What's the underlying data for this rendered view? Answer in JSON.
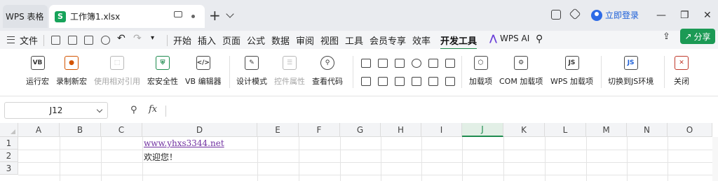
{
  "titlebar": {
    "app_tab": "WPS 表格",
    "doc_tab": "工作簿1.xlsx",
    "doc_icon": "S",
    "new_tab": "+",
    "login": "立即登录",
    "win_minimize": "—",
    "win_maximize": "❐",
    "win_close": "✕"
  },
  "menubar": {
    "file": "文件",
    "items": [
      "开始",
      "插入",
      "页面",
      "公式",
      "数据",
      "审阅",
      "视图",
      "工具",
      "会员专享",
      "效率",
      "开发工具",
      "WPS AI"
    ],
    "active": "开发工具",
    "share": "分享"
  },
  "ribbon": {
    "buttons": [
      {
        "label": "运行宏",
        "glyph": "VB",
        "disabled": false
      },
      {
        "label": "录制新宏",
        "glyph": "●",
        "disabled": false
      },
      {
        "label": "使用相对引用",
        "glyph": "⬚",
        "disabled": true
      },
      {
        "label": "宏安全性",
        "glyph": "⛨",
        "disabled": false
      },
      {
        "label": "VB 编辑器",
        "glyph": "</>",
        "disabled": false
      },
      {
        "label": "设计模式",
        "glyph": "✎",
        "disabled": false
      },
      {
        "label": "控件属性",
        "glyph": "☰",
        "disabled": true
      },
      {
        "label": "查看代码",
        "glyph": "⚲",
        "disabled": false
      },
      {
        "label": "加载项",
        "glyph": "⬡",
        "disabled": false
      },
      {
        "label": "COM 加载项",
        "glyph": "⚙",
        "disabled": false
      },
      {
        "label": "WPS 加载项",
        "glyph": "JS",
        "disabled": false
      },
      {
        "label": "切换到JS环境",
        "glyph": "JS",
        "disabled": false
      },
      {
        "label": "关闭",
        "glyph": "✕",
        "disabled": false
      }
    ]
  },
  "formulabar": {
    "namebox": "J12",
    "fx": "fx",
    "value": ""
  },
  "sheet": {
    "columns": [
      "A",
      "B",
      "C",
      "D",
      "E",
      "F",
      "G",
      "H",
      "I",
      "J",
      "K",
      "L",
      "M",
      "N",
      "O"
    ],
    "active_column": "J",
    "rows": [
      "1",
      "2",
      "3"
    ],
    "cells": {
      "D1": "www.yhxs3344.net",
      "D2": "欢迎您！"
    }
  },
  "colors": {
    "accent": "#1e8b4e",
    "share": "#1c9a55",
    "link": "#7030a0",
    "login": "#1c5fd8"
  }
}
